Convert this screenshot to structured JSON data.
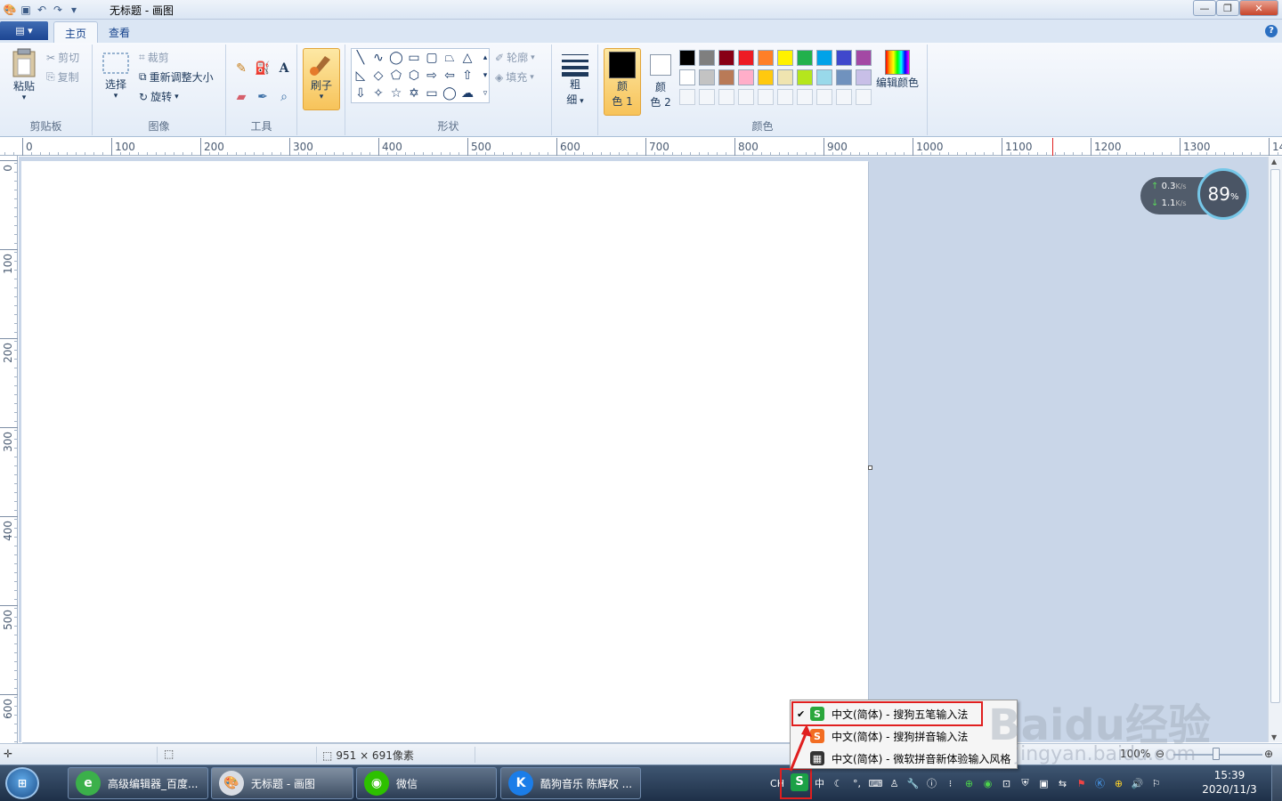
{
  "window": {
    "title": "无标题 - 画图",
    "quick_access": [
      "app-icon",
      "save-icon",
      "undo-icon",
      "redo-icon",
      "customize-icon"
    ]
  },
  "tabs": [
    {
      "label": "主页",
      "active": true
    },
    {
      "label": "查看",
      "active": false
    }
  ],
  "ribbon": {
    "clipboard": {
      "paste": "粘贴",
      "cut": "剪切",
      "copy": "复制",
      "group": "剪贴板"
    },
    "image": {
      "select": "选择",
      "crop": "裁剪",
      "resize": "重新调整大小",
      "rotate": "旋转",
      "group": "图像"
    },
    "tools": {
      "group": "工具",
      "text_tool": "A"
    },
    "brushes": {
      "label": "刷子"
    },
    "shapes": {
      "outline": "轮廓",
      "fill": "填充",
      "group": "形状"
    },
    "size": {
      "label_1": "粗",
      "label_2": "细"
    },
    "colors": {
      "color1_a": "颜",
      "color1_b": "色 1",
      "color2_a": "颜",
      "color2_b": "色 2",
      "edit": "编辑颜色",
      "group": "颜色",
      "palette_row1": [
        "#000000",
        "#7f7f7f",
        "#880015",
        "#ed1c24",
        "#ff7f27",
        "#fff200",
        "#22b14c",
        "#00a2e8",
        "#3f48cc",
        "#a349a4"
      ],
      "palette_row2": [
        "#ffffff",
        "#c3c3c3",
        "#b97a57",
        "#ffaec9",
        "#ffc90e",
        "#efe4b0",
        "#b5e61d",
        "#99d9ea",
        "#7092be",
        "#c8bfe7"
      ]
    }
  },
  "ruler": {
    "h_labels": [
      "0",
      "100",
      "200",
      "300",
      "400",
      "500",
      "600",
      "700",
      "800",
      "900",
      "1000",
      "1100",
      "1200",
      "1300",
      "14"
    ],
    "v_labels": [
      "0",
      "100",
      "200",
      "300",
      "400",
      "500",
      "600"
    ]
  },
  "speed_widget": {
    "up": "0.3",
    "down": "1.1",
    "unit": "K/s",
    "percent": "89",
    "percent_sign": "%"
  },
  "statusbar": {
    "size": "951 × 691像素",
    "zoom": "100%"
  },
  "ime_menu": [
    {
      "label": "中文(简体) - 搜狗五笔输入法",
      "checked": true
    },
    {
      "label": "中文(简体) - 搜狗拼音输入法",
      "checked": false
    },
    {
      "label": "中文(简体) - 微软拼音新体验输入风格",
      "checked": false
    }
  ],
  "taskbar": {
    "items": [
      {
        "label": "高级编辑器_百度...",
        "icon": "browser-icon"
      },
      {
        "label": "无标题 - 画图",
        "icon": "paint-icon",
        "active": true
      },
      {
        "label": "微信",
        "icon": "wechat-icon"
      },
      {
        "label": "酷狗音乐 陈辉权 ...",
        "icon": "kugou-icon"
      }
    ],
    "tray_lang": "CH",
    "tray_ime": "中",
    "clock_time": "15:39",
    "clock_date": "2020/11/3"
  },
  "watermark": {
    "text": "Baidu经验",
    "sub": "jingyan.baidu.com"
  }
}
